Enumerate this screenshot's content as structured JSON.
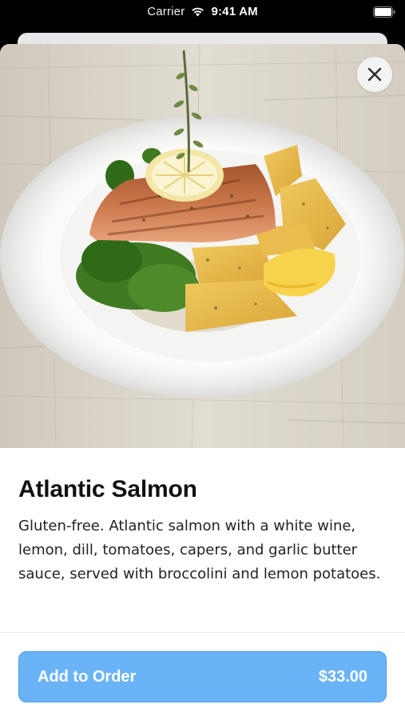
{
  "status_bar": {
    "carrier": "Carrier",
    "time": "9:41 AM"
  },
  "item": {
    "title": "Atlantic Salmon",
    "description": "Gluten-free. Atlantic salmon with a white wine, lemon, dill, tomatoes, capers, and garlic butter sauce, served with broccolini and lemon potatoes."
  },
  "order_button": {
    "label": "Add to Order",
    "price": "$33.00"
  },
  "icons": {
    "close": "close-icon",
    "wifi": "wifi-icon",
    "battery": "battery-icon"
  },
  "colors": {
    "button_bg": "#6ab3f7",
    "button_text": "#ffffff",
    "title_text": "#111111"
  }
}
